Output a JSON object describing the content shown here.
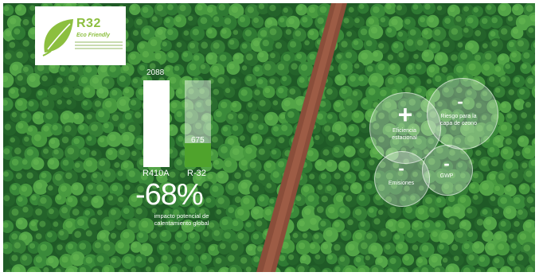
{
  "logo": {
    "title": "R32",
    "subtitle": "Eco Friendly"
  },
  "chart_data": {
    "type": "bar",
    "categories": [
      "R410A",
      "R-32"
    ],
    "values": [
      2088,
      675
    ]
  },
  "headline": {
    "value": "-68%",
    "description": "impacto potencial de calentamiento global"
  },
  "bubbles": [
    {
      "symbol": "+",
      "label": "Eficiencia estacional"
    },
    {
      "symbol": "-",
      "label": "Riesgo para la capa de ozono"
    },
    {
      "symbol": "-",
      "label": "Emisiones"
    },
    {
      "symbol": "-",
      "label": "GWP"
    }
  ]
}
